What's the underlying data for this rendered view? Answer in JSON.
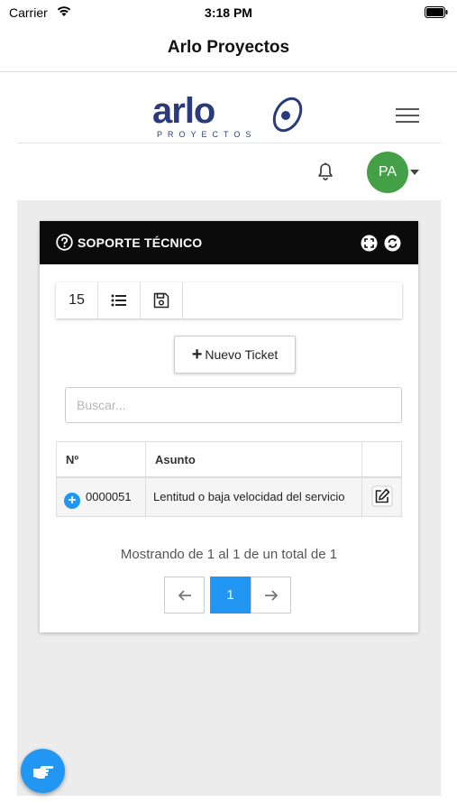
{
  "status_bar": {
    "carrier": "Carrier",
    "time": "3:18 PM"
  },
  "nav": {
    "title": "Arlo Proyectos"
  },
  "header": {
    "logo_text": "arlo",
    "logo_subtext": "PROYECTOS",
    "avatar_initials": "PA",
    "avatar_color": "#43a047"
  },
  "card": {
    "title": "SOPORTE TÉCNICO",
    "page_size": "15",
    "new_ticket_label": "Nuevo Ticket",
    "search_placeholder": "Buscar...",
    "columns": [
      "Nº",
      "Asunto"
    ],
    "rows": [
      {
        "number": "0000051",
        "subject": "Lentitud o baja velocidad del servicio"
      }
    ],
    "pagination_info": "Mostrando de 1 al 1 de un total de 1",
    "current_page": "1"
  },
  "colors": {
    "accent": "#2196f3",
    "header_bg": "#0b0b0b",
    "content_bg": "#ececec"
  }
}
